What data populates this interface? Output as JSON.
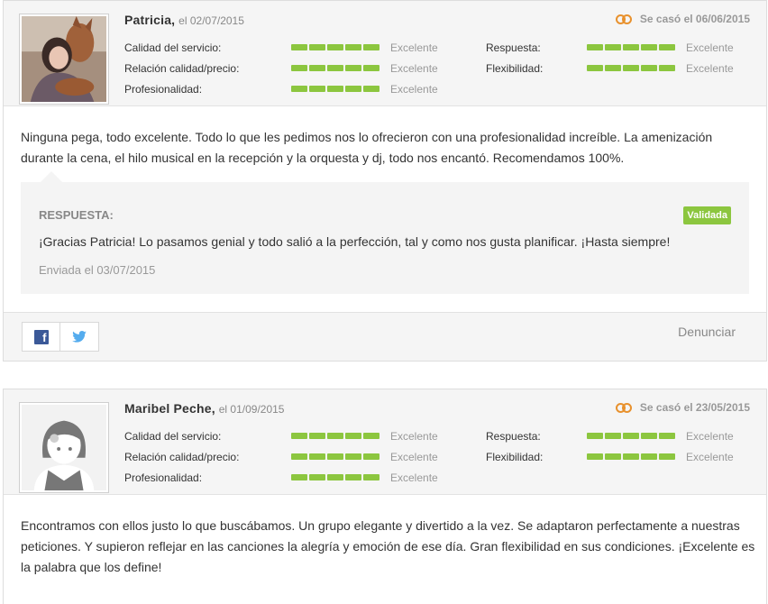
{
  "reviews": [
    {
      "author": "Patricia,",
      "date": "el 02/07/2015",
      "married": "Se casó el 06/06/2015",
      "ratings_left": [
        {
          "label": "Calidad del servicio:",
          "value": "Excelente",
          "score": 5
        },
        {
          "label": "Relación calidad/precio:",
          "value": "Excelente",
          "score": 5
        },
        {
          "label": "Profesionalidad:",
          "value": "Excelente",
          "score": 5
        }
      ],
      "ratings_right": [
        {
          "label": "Respuesta:",
          "value": "Excelente",
          "score": 5
        },
        {
          "label": "Flexibilidad:",
          "value": "Excelente",
          "score": 5
        }
      ],
      "text": "Ninguna pega, todo excelente. Todo lo que les pedimos nos lo ofrecieron con una profesionalidad increíble. La amenización durante la cena, el hilo musical en la recepción y la orquesta y dj, todo nos encantó. Recomendamos 100%.",
      "reply": {
        "title": "RESPUESTA:",
        "badge": "Validada",
        "text": "¡Gracias Patricia! Lo pasamos genial y todo salió a la perfección, tal y como nos gusta planificar. ¡Hasta siempre!",
        "sent": "Enviada el 03/07/2015"
      },
      "report_label": "Denunciar"
    },
    {
      "author": "Maribel Peche,",
      "date": "el 01/09/2015",
      "married": "Se casó el 23/05/2015",
      "ratings_left": [
        {
          "label": "Calidad del servicio:",
          "value": "Excelente",
          "score": 5
        },
        {
          "label": "Relación calidad/precio:",
          "value": "Excelente",
          "score": 5
        },
        {
          "label": "Profesionalidad:",
          "value": "Excelente",
          "score": 5
        }
      ],
      "ratings_right": [
        {
          "label": "Respuesta:",
          "value": "Excelente",
          "score": 5
        },
        {
          "label": "Flexibilidad:",
          "value": "Excelente",
          "score": 5
        }
      ],
      "text": "Encontramos con ellos justo lo que buscábamos. Un grupo elegante y divertido a la vez. Se adaptaron perfectamente a nuestras peticiones. Y supieron reflejar en las canciones la alegría y emoción de ese día. Gran flexibilidad en sus condiciones. ¡Excelente es la palabra que los define!"
    }
  ],
  "icons": {
    "rings": "wedding-rings-icon",
    "facebook": "facebook-icon",
    "twitter": "twitter-icon"
  },
  "colors": {
    "rating_bar": "#8cc63f",
    "rings": "#e8912d",
    "badge": "#8cc63f",
    "facebook": "#3b5998",
    "twitter": "#55acee"
  }
}
